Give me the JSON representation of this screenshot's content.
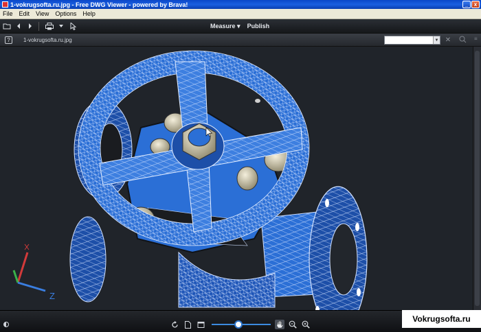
{
  "window": {
    "title": "1-vokrugsofta.ru.jpg - Free DWG Viewer - powered by Brava!",
    "min_glyph": "_",
    "close_glyph": "x"
  },
  "menu": {
    "items": [
      "File",
      "Edit",
      "View",
      "Options",
      "Help"
    ]
  },
  "toolbar": {
    "measure_label": "Measure",
    "publish_label": "Publish"
  },
  "tabstrip": {
    "help_label": "?",
    "filename": "1-vokrugsofta.ru.jpg",
    "search_value": ""
  },
  "viewport": {
    "axis_x_label": "X",
    "axis_z_label": "Z",
    "accent_blue": "#2b6fd6",
    "wire_color": "#cfe0ff",
    "bolt_color": "#d9d2b8",
    "background": "#20242a"
  },
  "statusbar": {
    "zoom_level": 0.45
  },
  "watermark": {
    "text": "Vokrugsofta.ru"
  },
  "icons": [
    "folder-icon",
    "back-arrow-icon",
    "forward-arrow-icon",
    "print-icon",
    "pointer-icon",
    "rotate-icon",
    "document-icon",
    "page-icon",
    "pan-hand-icon",
    "zoom-icon",
    "zoom-in-icon"
  ]
}
